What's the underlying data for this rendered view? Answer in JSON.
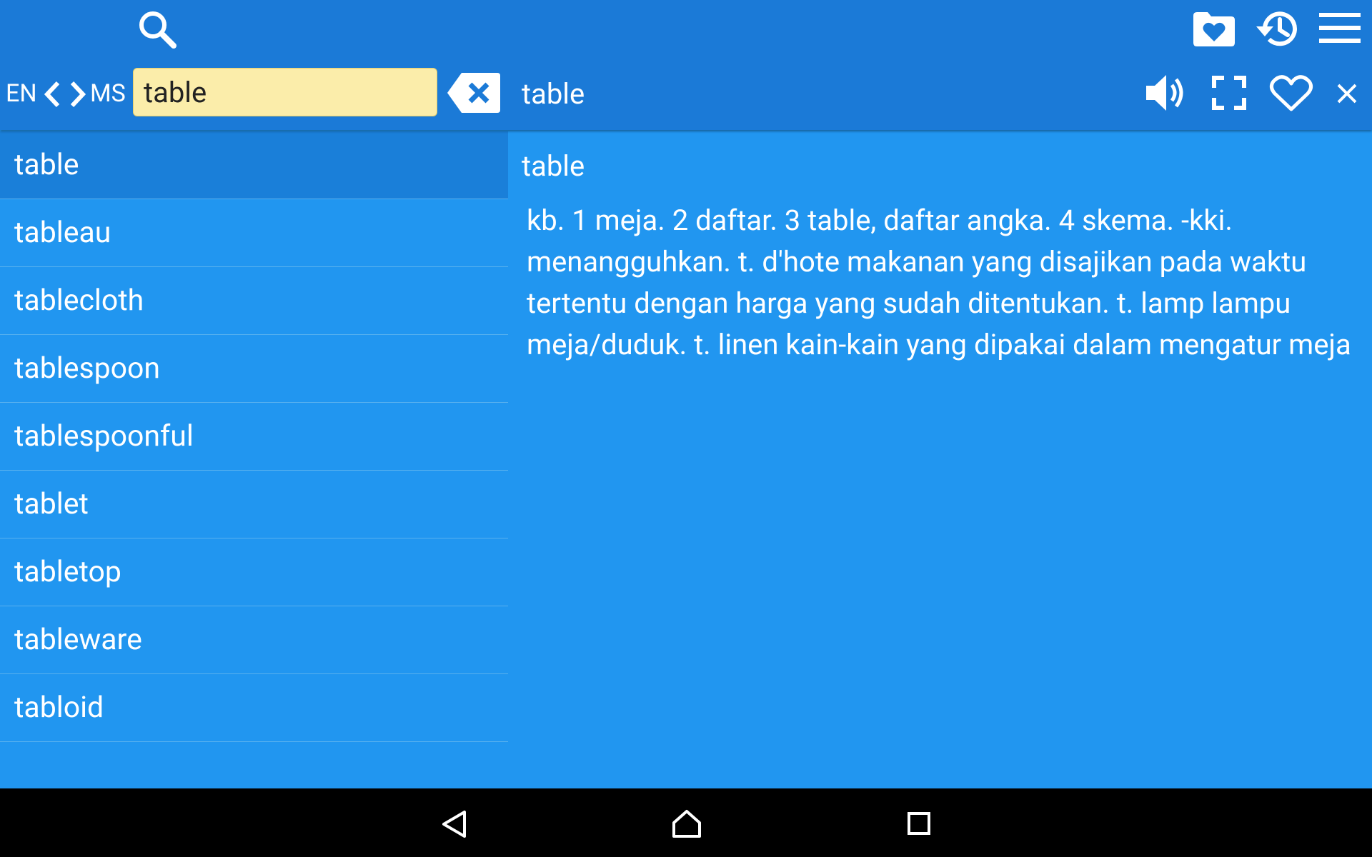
{
  "toolbar": {
    "search_icon": "search-icon",
    "favorites_folder_icon": "favorites-folder-icon",
    "history_icon": "history-icon",
    "menu_icon": "menu-icon"
  },
  "language": {
    "source": "EN",
    "target": "MS",
    "swap_left_icon": "chevron-left-icon",
    "swap_right_icon": "chevron-right-icon"
  },
  "search": {
    "value": "table",
    "placeholder": "",
    "clear_icon": "backspace-clear-icon"
  },
  "entry_header": {
    "headword": "table",
    "speaker_icon": "speaker-icon",
    "fullscreen_icon": "fullscreen-icon",
    "favorite_icon": "heart-icon",
    "close_icon": "close-icon"
  },
  "word_list": [
    {
      "label": "table",
      "selected": true
    },
    {
      "label": "tableau",
      "selected": false
    },
    {
      "label": "tablecloth",
      "selected": false
    },
    {
      "label": "tablespoon",
      "selected": false
    },
    {
      "label": "tablespoonful",
      "selected": false
    },
    {
      "label": "tablet",
      "selected": false
    },
    {
      "label": "tabletop",
      "selected": false
    },
    {
      "label": "tableware",
      "selected": false
    },
    {
      "label": "tabloid",
      "selected": false
    }
  ],
  "entry": {
    "title": "table",
    "definition": "kb. 1 meja. 2 daftar. 3 table, daftar angka. 4 skema. -kki. menangguhkan. t. d'hote makanan yang disajikan pada waktu tertentu dengan harga yang sudah ditentukan. t. lamp lampu meja/duduk. t. linen kain-kain yang dipakai dalam mengatur meja"
  },
  "navbar": {
    "back_icon": "back-icon",
    "home_icon": "home-icon",
    "recents_icon": "recents-icon"
  },
  "colors": {
    "toolbar": "#1b7ad7",
    "background": "#2196f0",
    "selected_row": "#1a7fd9",
    "search_box": "#fbedaa"
  }
}
